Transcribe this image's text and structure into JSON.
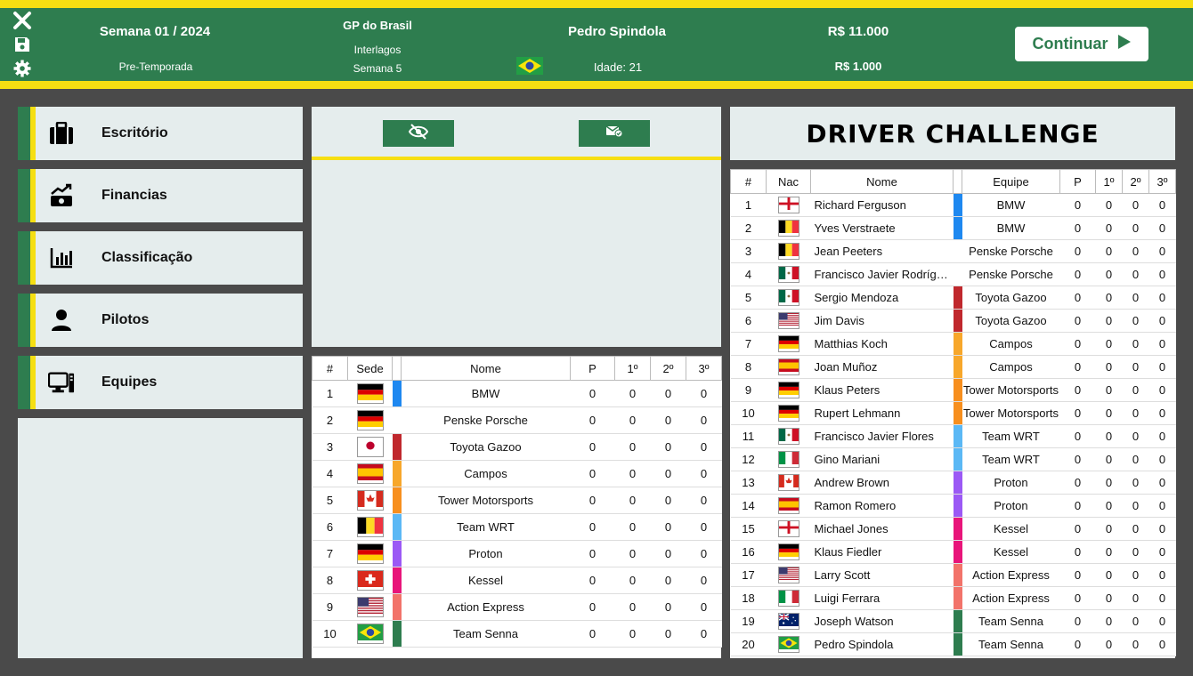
{
  "header": {
    "week": "Semana 01 / 2024",
    "phase": "Pre-Temporada",
    "gp_name": "GP do Brasil",
    "circuit": "Interlagos",
    "race_week": "Semana 5",
    "player_name": "Pedro Spindola",
    "player_age": "Idade: 21",
    "balance": "R$ 11.000",
    "salary": "R$ 1.000",
    "continue_label": "Continuar",
    "icons": [
      "close-icon",
      "save-icon",
      "gear-icon"
    ]
  },
  "colors": {
    "green": "#2e7d4f",
    "yellow": "#f6df12",
    "panel": "#e5eded",
    "background": "#4a4a4a"
  },
  "sidebar": {
    "items": [
      {
        "label": "Escritório",
        "icon": "briefcase-icon"
      },
      {
        "label": "Financias",
        "icon": "finance-chart-icon"
      },
      {
        "label": "Classificação",
        "icon": "bar-chart-icon"
      },
      {
        "label": "Pilotos",
        "icon": "person-icon"
      },
      {
        "label": "Equipes",
        "icon": "computer-icon"
      }
    ]
  },
  "middle": {
    "buttons": [
      {
        "icon": "eye-off-icon"
      },
      {
        "icon": "mail-check-icon"
      }
    ]
  },
  "team_table": {
    "headers": [
      "#",
      "Sede",
      "",
      "Nome",
      "P",
      "1º",
      "2º",
      "3º"
    ],
    "rows": [
      {
        "pos": "1",
        "flag": "de",
        "color": "#1e88f0",
        "name": "BMW",
        "p": "0",
        "w1": "0",
        "w2": "0",
        "w3": "0"
      },
      {
        "pos": "2",
        "flag": "de",
        "color": "#ffffff",
        "name": "Penske Porsche",
        "p": "0",
        "w1": "0",
        "w2": "0",
        "w3": "0"
      },
      {
        "pos": "3",
        "flag": "jp",
        "color": "#c0282d",
        "name": "Toyota Gazoo",
        "p": "0",
        "w1": "0",
        "w2": "0",
        "w3": "0"
      },
      {
        "pos": "4",
        "flag": "es",
        "color": "#f7a72b",
        "name": "Campos",
        "p": "0",
        "w1": "0",
        "w2": "0",
        "w3": "0"
      },
      {
        "pos": "5",
        "flag": "ca",
        "color": "#f78f1e",
        "name": "Tower Motorsports",
        "p": "0",
        "w1": "0",
        "w2": "0",
        "w3": "0"
      },
      {
        "pos": "6",
        "flag": "be",
        "color": "#5bb8f5",
        "name": "Team WRT",
        "p": "0",
        "w1": "0",
        "w2": "0",
        "w3": "0"
      },
      {
        "pos": "7",
        "flag": "de",
        "color": "#9b59f5",
        "name": "Proton",
        "p": "0",
        "w1": "0",
        "w2": "0",
        "w3": "0"
      },
      {
        "pos": "8",
        "flag": "ch",
        "color": "#e8157a",
        "name": "Kessel",
        "p": "0",
        "w1": "0",
        "w2": "0",
        "w3": "0"
      },
      {
        "pos": "9",
        "flag": "us",
        "color": "#f2736a",
        "name": "Action Express",
        "p": "0",
        "w1": "0",
        "w2": "0",
        "w3": "0"
      },
      {
        "pos": "10",
        "flag": "br",
        "color": "#2e7d4f",
        "name": "Team Senna",
        "p": "0",
        "w1": "0",
        "w2": "0",
        "w3": "0"
      }
    ]
  },
  "driver_challenge": {
    "title": "DRIVER CHALLENGE",
    "headers": [
      "#",
      "Nac",
      "Nome",
      "",
      "Equipe",
      "P",
      "1º",
      "2º",
      "3º"
    ],
    "rows": [
      {
        "pos": "1",
        "flag": "en",
        "name": "Richard Ferguson",
        "color": "#1e88f0",
        "team": "BMW",
        "p": "0",
        "w1": "0",
        "w2": "0",
        "w3": "0"
      },
      {
        "pos": "2",
        "flag": "be",
        "name": "Yves Verstraete",
        "color": "#1e88f0",
        "team": "BMW",
        "p": "0",
        "w1": "0",
        "w2": "0",
        "w3": "0"
      },
      {
        "pos": "3",
        "flag": "be",
        "name": "Jean Peeters",
        "color": "#ffffff",
        "team": "Penske Porsche",
        "p": "0",
        "w1": "0",
        "w2": "0",
        "w3": "0"
      },
      {
        "pos": "4",
        "flag": "mx",
        "name": "Francisco Javier Rodríguez",
        "color": "#ffffff",
        "team": "Penske Porsche",
        "p": "0",
        "w1": "0",
        "w2": "0",
        "w3": "0"
      },
      {
        "pos": "5",
        "flag": "mx",
        "name": "Sergio Mendoza",
        "color": "#c0282d",
        "team": "Toyota Gazoo",
        "p": "0",
        "w1": "0",
        "w2": "0",
        "w3": "0"
      },
      {
        "pos": "6",
        "flag": "us",
        "name": "Jim Davis",
        "color": "#c0282d",
        "team": "Toyota Gazoo",
        "p": "0",
        "w1": "0",
        "w2": "0",
        "w3": "0"
      },
      {
        "pos": "7",
        "flag": "de",
        "name": "Matthias Koch",
        "color": "#f7a72b",
        "team": "Campos",
        "p": "0",
        "w1": "0",
        "w2": "0",
        "w3": "0"
      },
      {
        "pos": "8",
        "flag": "es",
        "name": "Joan Muñoz",
        "color": "#f7a72b",
        "team": "Campos",
        "p": "0",
        "w1": "0",
        "w2": "0",
        "w3": "0"
      },
      {
        "pos": "9",
        "flag": "de",
        "name": "Klaus Peters",
        "color": "#f78f1e",
        "team": "Tower Motorsports",
        "p": "0",
        "w1": "0",
        "w2": "0",
        "w3": "0"
      },
      {
        "pos": "10",
        "flag": "de",
        "name": "Rupert Lehmann",
        "color": "#f78f1e",
        "team": "Tower Motorsports",
        "p": "0",
        "w1": "0",
        "w2": "0",
        "w3": "0"
      },
      {
        "pos": "11",
        "flag": "mx",
        "name": "Francisco Javier Flores",
        "color": "#5bb8f5",
        "team": "Team WRT",
        "p": "0",
        "w1": "0",
        "w2": "0",
        "w3": "0"
      },
      {
        "pos": "12",
        "flag": "it",
        "name": "Gino Mariani",
        "color": "#5bb8f5",
        "team": "Team WRT",
        "p": "0",
        "w1": "0",
        "w2": "0",
        "w3": "0"
      },
      {
        "pos": "13",
        "flag": "ca",
        "name": "Andrew Brown",
        "color": "#9b59f5",
        "team": "Proton",
        "p": "0",
        "w1": "0",
        "w2": "0",
        "w3": "0"
      },
      {
        "pos": "14",
        "flag": "es",
        "name": "Ramon Romero",
        "color": "#9b59f5",
        "team": "Proton",
        "p": "0",
        "w1": "0",
        "w2": "0",
        "w3": "0"
      },
      {
        "pos": "15",
        "flag": "en",
        "name": "Michael Jones",
        "color": "#e8157a",
        "team": "Kessel",
        "p": "0",
        "w1": "0",
        "w2": "0",
        "w3": "0"
      },
      {
        "pos": "16",
        "flag": "de",
        "name": "Klaus Fiedler",
        "color": "#e8157a",
        "team": "Kessel",
        "p": "0",
        "w1": "0",
        "w2": "0",
        "w3": "0"
      },
      {
        "pos": "17",
        "flag": "us",
        "name": "Larry Scott",
        "color": "#f2736a",
        "team": "Action Express",
        "p": "0",
        "w1": "0",
        "w2": "0",
        "w3": "0"
      },
      {
        "pos": "18",
        "flag": "it",
        "name": "Luigi Ferrara",
        "color": "#f2736a",
        "team": "Action Express",
        "p": "0",
        "w1": "0",
        "w2": "0",
        "w3": "0"
      },
      {
        "pos": "19",
        "flag": "au",
        "name": "Joseph Watson",
        "color": "#2e7d4f",
        "team": "Team Senna",
        "p": "0",
        "w1": "0",
        "w2": "0",
        "w3": "0"
      },
      {
        "pos": "20",
        "flag": "br",
        "name": "Pedro Spindola",
        "color": "#2e7d4f",
        "team": "Team Senna",
        "p": "0",
        "w1": "0",
        "w2": "0",
        "w3": "0"
      }
    ]
  }
}
